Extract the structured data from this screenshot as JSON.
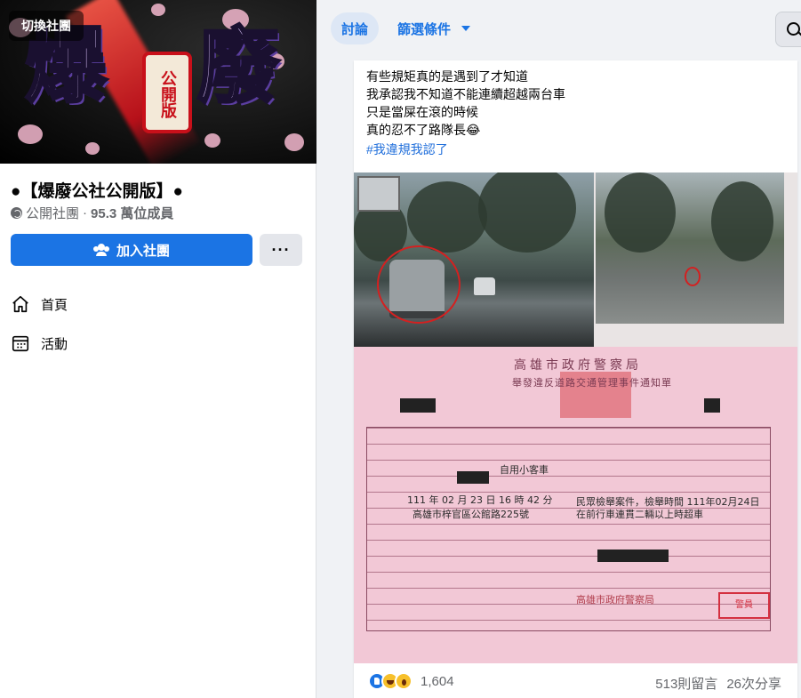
{
  "cover": {
    "switch_label": "切換社團"
  },
  "group": {
    "name": "●【爆廢公社公開版】●",
    "privacy": "公開社團",
    "members": "95.3 萬位成員",
    "join_label": "加入社團",
    "more_label": "···"
  },
  "nav": {
    "items": [
      {
        "label": "首頁",
        "icon": "home-icon"
      },
      {
        "label": "活動",
        "icon": "calendar-icon"
      }
    ]
  },
  "tabs": {
    "discussion": "討論",
    "filter": "篩選條件"
  },
  "post": {
    "lines": [
      "有些規矩真的是遇到了才知道",
      "我承認我不知道不能連續超越兩台車",
      "只是當屎在滾的時候",
      "真的忍不了路隊長😂"
    ],
    "hashtag": "#我違規我認了",
    "reaction_count": "1,604",
    "comments": "513則留言",
    "shares": "26次分享"
  },
  "colors": {
    "accent": "#1b74e4",
    "background": "#f0f2f5",
    "hashtag": "#216fdb",
    "ticket_pink": "#f2c8d6"
  }
}
